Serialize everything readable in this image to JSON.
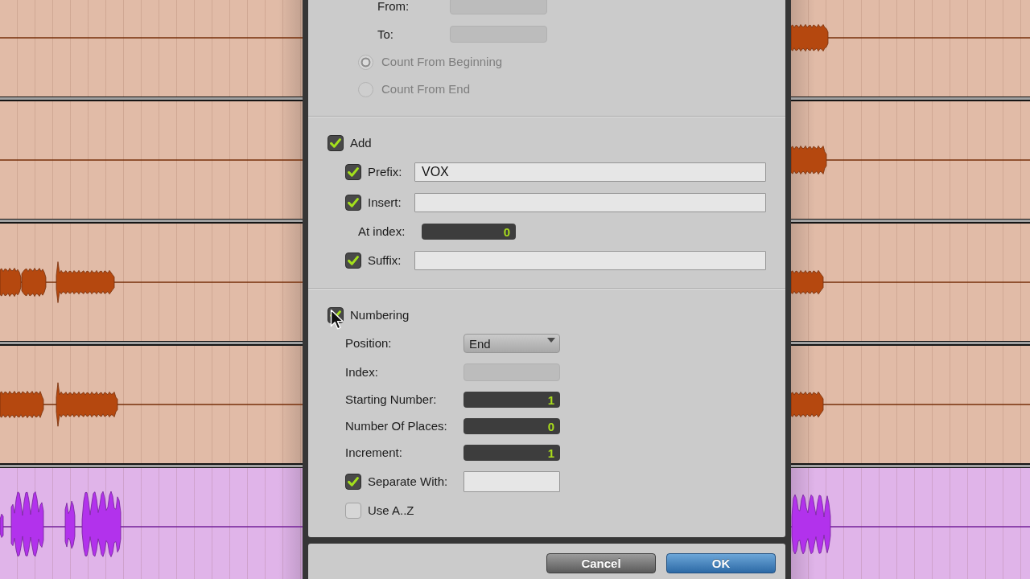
{
  "tracks": [
    {
      "color": "#b5480f"
    },
    {
      "color": "#b5480f"
    },
    {
      "color": "#b5480f"
    },
    {
      "color": "#b5480f"
    },
    {
      "color": "#b232ec"
    }
  ],
  "dialog": {
    "range": {
      "fields": [
        {
          "kind": "field",
          "label": "From:",
          "disabled": true
        },
        {
          "kind": "field",
          "label": "To:",
          "disabled": true
        }
      ],
      "count_options": [
        {
          "label": "Count From Beginning",
          "selected": true,
          "disabled": true
        },
        {
          "label": "Count From End",
          "selected": false,
          "disabled": true
        }
      ]
    },
    "add": {
      "label": "Add",
      "checked": true,
      "rows": [
        {
          "kind": "check-field",
          "label": "Prefix:",
          "checked": true,
          "value": "VOX"
        },
        {
          "kind": "check-field",
          "label": "Insert:",
          "checked": true
        },
        {
          "kind": "number",
          "label": "At index:",
          "value": "0"
        },
        {
          "kind": "check-field",
          "label": "Suffix:",
          "checked": true
        }
      ]
    },
    "numbering": {
      "label": "Numbering",
      "checked": true,
      "rows": [
        {
          "kind": "dropdown",
          "label": "Position:",
          "value": "End"
        },
        {
          "kind": "field",
          "label": "Index:",
          "disabled": true
        },
        {
          "kind": "number",
          "label": "Starting Number:",
          "value": "1"
        },
        {
          "kind": "number",
          "label": "Number Of Places:",
          "value": "0"
        },
        {
          "kind": "number",
          "label": "Increment:",
          "value": "1"
        },
        {
          "kind": "check-field",
          "label": "Separate With:",
          "checked": true
        },
        {
          "kind": "check",
          "label": "Use A..Z",
          "checked": false
        }
      ]
    },
    "buttons": [
      {
        "label": "Cancel",
        "kind": "secondary"
      },
      {
        "label": "OK",
        "kind": "primary"
      }
    ]
  }
}
